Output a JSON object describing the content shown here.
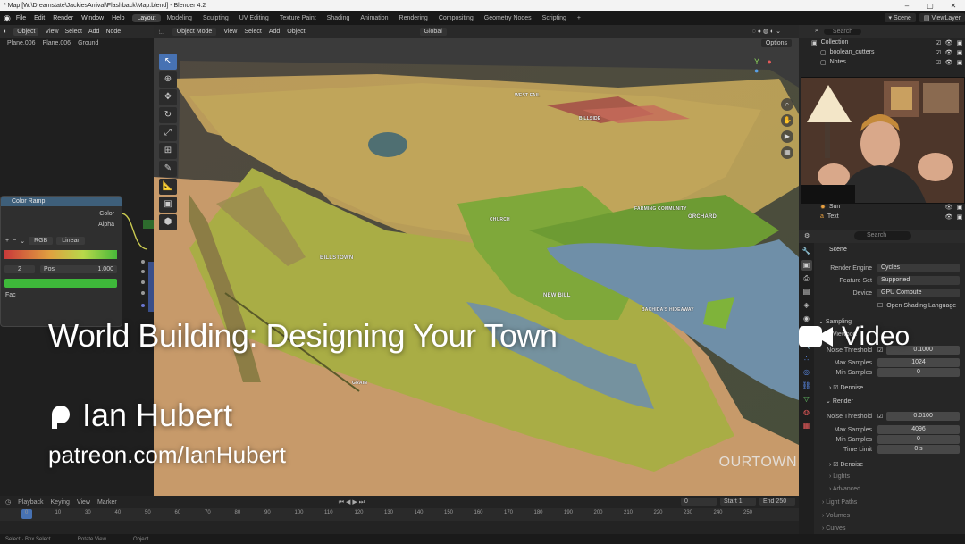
{
  "window": {
    "title": "* Map [W:\\Dreamstate\\JackiesArrival\\Flashback\\Map.blend] - Blender 4.2"
  },
  "menu": {
    "items": [
      "File",
      "Edit",
      "Render",
      "Window",
      "Help"
    ],
    "workspaces": [
      "Layout",
      "Modeling",
      "Sculpting",
      "UV Editing",
      "Texture Paint",
      "Shading",
      "Animation",
      "Rendering",
      "Compositing",
      "Geometry Nodes",
      "Scripting"
    ],
    "add_tab": "+",
    "scene_label": "Scene",
    "viewlayer_label": "ViewLayer"
  },
  "node_editor": {
    "header": [
      "Object",
      "View",
      "Select",
      "Add",
      "Node"
    ],
    "breadcrumb": [
      "Plane.006",
      "Plane.006",
      "Ground"
    ],
    "color_ramp": {
      "title": "Color Ramp",
      "outputs": [
        "Color",
        "Alpha"
      ],
      "buttons": [
        "+",
        "−",
        "⌄"
      ],
      "color_mode": "RGB",
      "interpolation": "Linear",
      "stop_index": "2",
      "pos_label": "Pos",
      "pos_value": "1.000",
      "input_label": "Fac"
    }
  },
  "viewport": {
    "header": {
      "mode": "Object Mode",
      "menus": [
        "View",
        "Select",
        "Add",
        "Object"
      ],
      "transform": "Global",
      "options": "Options"
    },
    "map_labels": [
      {
        "text": "WEST FAIL",
        "id": "west-fail"
      },
      {
        "text": "BILLSIDE",
        "id": "billside"
      },
      {
        "text": "FARMING COMMUNITY",
        "id": "farming-community"
      },
      {
        "text": "ORCHARD",
        "id": "orchard"
      },
      {
        "text": "BILLSTOWN",
        "id": "billstown"
      },
      {
        "text": "CHURCH",
        "id": "church"
      },
      {
        "text": "NEW BILL",
        "id": "new-bill"
      },
      {
        "text": "BACHIDA'S HIDEAWAY",
        "id": "hideaway"
      },
      {
        "text": "GRAIN",
        "id": "grain"
      }
    ],
    "watermark": "OURTOWN"
  },
  "outliner": {
    "search_placeholder": "Search",
    "rows": [
      {
        "name": "Collection",
        "indent": 0
      },
      {
        "name": "boolean_cutters",
        "indent": 1
      },
      {
        "name": "Notes",
        "indent": 1
      },
      {
        "name": "Sun",
        "indent": 1
      },
      {
        "name": "Text",
        "indent": 1
      }
    ]
  },
  "properties": {
    "search_placeholder": "Search",
    "context": "Scene",
    "render_engine_label": "Render Engine",
    "render_engine": "Cycles",
    "feature_set_label": "Feature Set",
    "feature_set": "Supported",
    "device_label": "Device",
    "device": "GPU Compute",
    "osl_label": "Open Shading Language",
    "sampling_label": "Sampling",
    "viewport_label": "Viewport",
    "noise_threshold_label": "Noise Threshold",
    "viewport_noise_threshold": "0.1000",
    "max_samples_label": "Max Samples",
    "viewport_max_samples": "1024",
    "min_samples_label": "Min Samples",
    "viewport_min_samples": "0",
    "denoise_label": "Denoise",
    "render_label": "Render",
    "render_noise_threshold": "0.0100",
    "render_max_samples": "4096",
    "render_min_samples": "0",
    "time_limit_label": "Time Limit",
    "time_limit": "0 s",
    "render_denoise_label": "Denoise",
    "lights_label": "Lights",
    "advanced_label": "Advanced",
    "light_paths_label": "Light Paths",
    "volumes_label": "Volumes",
    "curves_label": "Curves"
  },
  "timeline": {
    "menus": [
      "Playback",
      "Keying",
      "View",
      "Marker"
    ],
    "current_frame": "0",
    "start_label": "Start",
    "start": "1",
    "end_label": "End",
    "end": "250",
    "ruler": [
      "0",
      "10",
      "30",
      "40",
      "50",
      "60",
      "70",
      "80",
      "90",
      "100",
      "110",
      "120",
      "130",
      "140",
      "150",
      "160",
      "170",
      "180",
      "190",
      "200",
      "210",
      "220",
      "230",
      "240",
      "250"
    ]
  },
  "status": {
    "left": "Select  ·  Box Select",
    "middle": "Rotate View",
    "right": "Object"
  },
  "overlay": {
    "title": "World Building: Designing Your Town",
    "author": "Ian Hubert",
    "url": "patreon.com/IanHubert",
    "badge": "Video"
  }
}
